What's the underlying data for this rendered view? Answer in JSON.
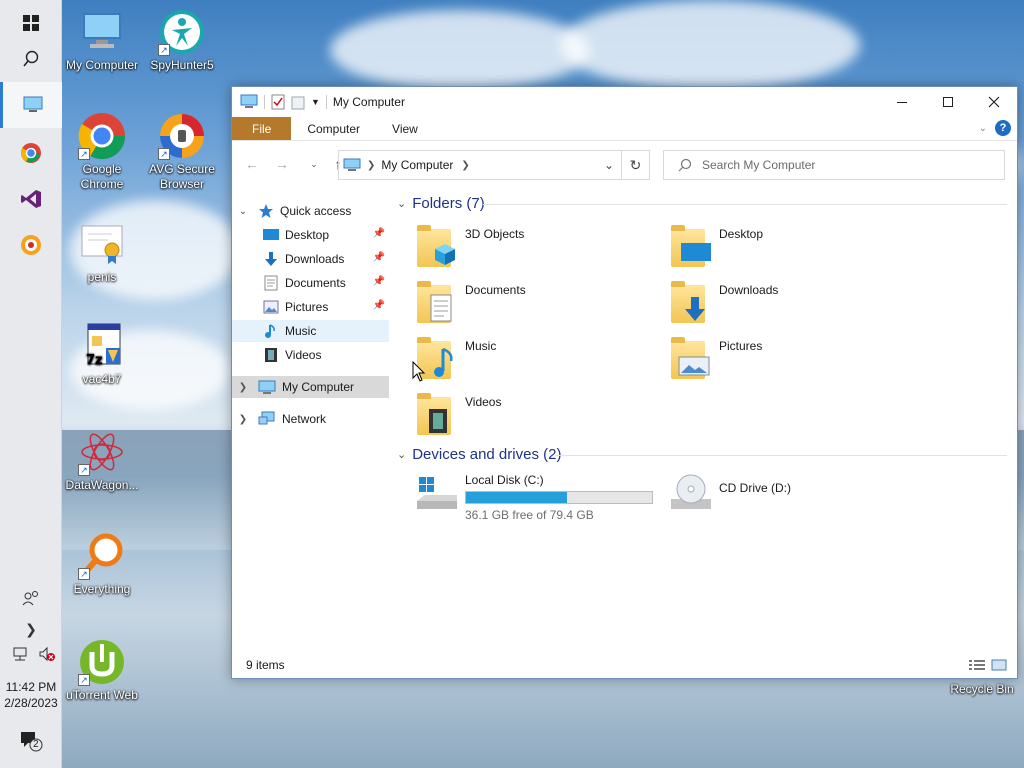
{
  "desktop": {
    "icons": [
      {
        "label": "My Computer",
        "icon": "computer-icon"
      },
      {
        "label": "SpyHunter5",
        "icon": "spyhunter-icon"
      },
      {
        "label": "Google Chrome",
        "icon": "chrome-icon"
      },
      {
        "label": "AVG Secure Browser",
        "icon": "avg-browser-icon"
      },
      {
        "label": "penis",
        "icon": "certificate-file-icon"
      },
      {
        "label": "vac4b7",
        "icon": "installer-icon"
      },
      {
        "label": "DataWagon...",
        "icon": "datawagon-icon"
      },
      {
        "label": "Everything",
        "icon": "everything-search-icon"
      },
      {
        "label": "uTorrent Web",
        "icon": "utorrent-icon"
      },
      {
        "label": "Recycle Bin",
        "icon": "recycle-bin-icon"
      }
    ]
  },
  "taskbar": {
    "time": "11:42 PM",
    "date": "2/28/2023",
    "notification_count": "2",
    "accent": "#2b7cd3"
  },
  "window": {
    "title": "My Computer",
    "ribbon_tabs": [
      "File",
      "Computer",
      "View"
    ],
    "address": "My Computer",
    "search_placeholder": "Search My Computer",
    "nav": {
      "quick_access": "Quick access",
      "quick_items": [
        "Desktop",
        "Downloads",
        "Documents",
        "Pictures",
        "Music",
        "Videos"
      ],
      "my_computer": "My Computer",
      "network": "Network"
    },
    "folders_header": "Folders (7)",
    "folders": [
      "3D Objects",
      "Desktop",
      "Documents",
      "Downloads",
      "Music",
      "Pictures",
      "Videos"
    ],
    "drives_header": "Devices and drives (2)",
    "drives": [
      {
        "name": "Local Disk (C:)",
        "free": "36.1 GB free of 79.4 GB",
        "used_fraction": 0.545
      },
      {
        "name": "CD Drive (D:)"
      }
    ],
    "status": "9 items"
  }
}
